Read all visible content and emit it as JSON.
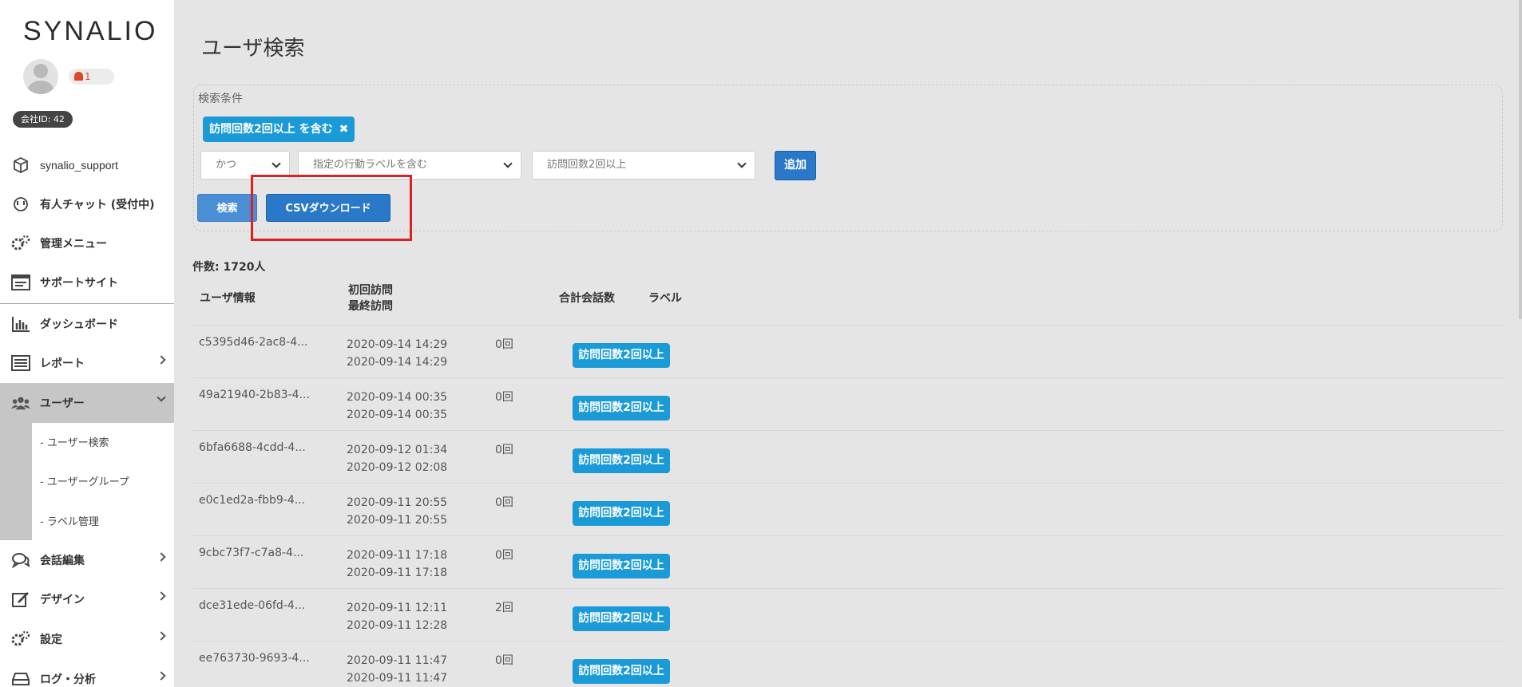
{
  "sidebar": {
    "logo": "SYNALIO",
    "notification_count": "1",
    "company_id": "会社ID: 42",
    "items": [
      {
        "label": "synalio_support"
      },
      {
        "label": "有人チャット (受付中)"
      },
      {
        "label": "管理メニュー"
      },
      {
        "label": "サポートサイト"
      },
      {
        "label": "ダッシュボード"
      },
      {
        "label": "レポート"
      },
      {
        "label": "ユーザー"
      },
      {
        "label": "会話編集"
      },
      {
        "label": "デザイン"
      },
      {
        "label": "設定"
      },
      {
        "label": "ログ・分析"
      }
    ],
    "sub_items": [
      {
        "label": "- ユーザー検索"
      },
      {
        "label": "- ユーザーグループ"
      },
      {
        "label": "- ラベル管理"
      }
    ]
  },
  "main": {
    "title": "ユーザ検索",
    "search": {
      "legend": "検索条件",
      "chip": "訪問回数2回以上 を含む",
      "chip_close": "✖",
      "select_logic": "かつ",
      "select_condition": "指定の行動ラベルを含む",
      "select_value": "訪問回数2回以上",
      "add_label": "追加",
      "search_label": "検索",
      "csv_label": "CSVダウンロード"
    },
    "count": "件数: 1720人",
    "headers": {
      "user_info": "ユーザ情報",
      "first_visit": "初回訪問",
      "last_visit": "最終訪問",
      "total_talks": "合計会話数",
      "label": "ラベル"
    },
    "rows": [
      {
        "uid": "c5395d46-2ac8-4...",
        "first": "2020-09-14 14:29",
        "last": "2020-09-14 14:29",
        "count": "0回",
        "label": "訪問回数2回以上"
      },
      {
        "uid": "49a21940-2b83-4...",
        "first": "2020-09-14 00:35",
        "last": "2020-09-14 00:35",
        "count": "0回",
        "label": "訪問回数2回以上"
      },
      {
        "uid": "6bfa6688-4cdd-4...",
        "first": "2020-09-12 01:34",
        "last": "2020-09-12 02:08",
        "count": "0回",
        "label": "訪問回数2回以上"
      },
      {
        "uid": "e0c1ed2a-fbb9-4...",
        "first": "2020-09-11 20:55",
        "last": "2020-09-11 20:55",
        "count": "0回",
        "label": "訪問回数2回以上"
      },
      {
        "uid": "9cbc73f7-c7a8-4...",
        "first": "2020-09-11 17:18",
        "last": "2020-09-11 17:18",
        "count": "0回",
        "label": "訪問回数2回以上"
      },
      {
        "uid": "dce31ede-06fd-4...",
        "first": "2020-09-11 12:11",
        "last": "2020-09-11 12:28",
        "count": "2回",
        "label": "訪問回数2回以上"
      },
      {
        "uid": "ee763730-9693-4...",
        "first": "2020-09-11 11:47",
        "last": "2020-09-11 11:47",
        "count": "0回",
        "label": "訪問回数2回以上"
      }
    ]
  },
  "colors": {
    "accent": "#1a9ad6",
    "button": "#2a78c8",
    "highlight": "#e02020"
  }
}
